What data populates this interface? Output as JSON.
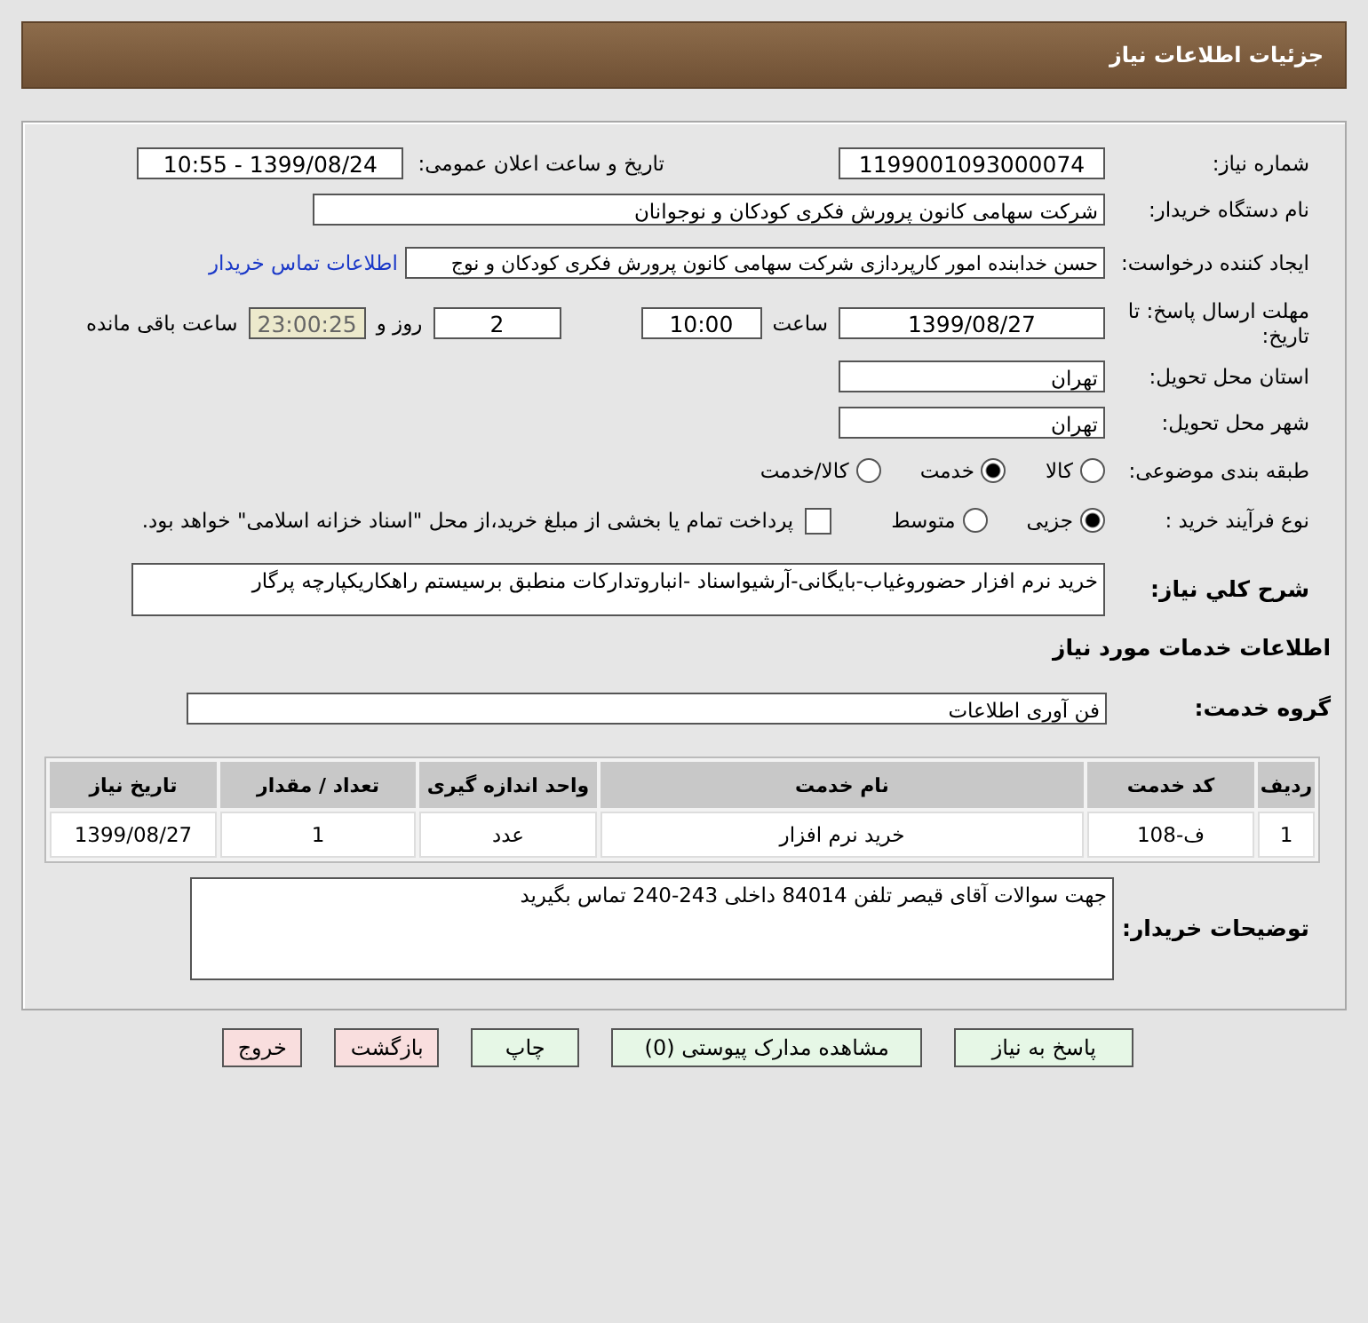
{
  "header": {
    "title": "جزئیات اطلاعات نیاز"
  },
  "need_number": {
    "label": "شماره نیاز:",
    "value": "1199001093000074"
  },
  "announce": {
    "label": "تاریخ و ساعت اعلان عمومی:",
    "value": "1399/08/24 - 10:55"
  },
  "buyer_org": {
    "label": "نام دستگاه خریدار:",
    "value": "شرکت سهامی کانون پرورش فکری کودکان و نوجوانان"
  },
  "requester": {
    "label": "ایجاد کننده درخواست:",
    "value": "حسن خدابنده امور کارپردازی  شرکت سهامی کانون پرورش فکری کودکان و نوج",
    "link": "اطلاعات تماس خریدار"
  },
  "deadline": {
    "label": "مهلت ارسال پاسخ: تا تاریخ:",
    "date": "1399/08/27",
    "time_label": "ساعت",
    "time": "10:00",
    "days": "2",
    "days_label": "روز و",
    "remaining": "23:00:25",
    "remaining_label": "ساعت باقی مانده"
  },
  "province": {
    "label": "استان محل تحویل:",
    "value": "تهران"
  },
  "city": {
    "label": "شهر محل تحویل:",
    "value": "تهران"
  },
  "category": {
    "label": "طبقه بندی موضوعی:",
    "options": [
      {
        "label": "کالا",
        "selected": false
      },
      {
        "label": "خدمت",
        "selected": true
      },
      {
        "label": "کالا/خدمت",
        "selected": false
      }
    ]
  },
  "purchase_process": {
    "label": "نوع فرآیند خرید :",
    "options": [
      {
        "label": "جزیی",
        "selected": true
      },
      {
        "label": "متوسط",
        "selected": false
      }
    ],
    "checkbox": {
      "label": "پرداخت تمام یا بخشی از مبلغ خرید،از محل \"اسناد خزانه اسلامی\" خواهد بود.",
      "checked": false
    }
  },
  "description": {
    "label": "شرح کلي نياز:",
    "value": "خرید نرم افزار حضوروغیاب-بایگانی-آرشیواسناد -انباروتدارکات منطبق برسیستم راهکاریکپارچه پرگار"
  },
  "services_title": "اطلاعات خدمات مورد نیاز",
  "service_group": {
    "label": "گروه خدمت:",
    "value": "فن آوری اطلاعات"
  },
  "table": {
    "columns": [
      "ردیف",
      "کد خدمت",
      "نام خدمت",
      "واحد اندازه گیری",
      "تعداد / مقدار",
      "تاریخ نیاز"
    ],
    "rows": [
      [
        "1",
        "ف-108",
        "خرید نرم افزار",
        "عدد",
        "1",
        "1399/08/27"
      ]
    ]
  },
  "buyer_notes": {
    "label": "توضیحات خریدار:",
    "value": "جهت سوالات آقای قیصر تلفن 84014 داخلی 243-240 تماس بگیرید"
  },
  "buttons": [
    {
      "label": "پاسخ به نیاز",
      "kind": "normal"
    },
    {
      "label": "مشاهده مدارک پیوستی (0)",
      "kind": "normal"
    },
    {
      "label": "چاپ",
      "kind": "normal"
    },
    {
      "label": "بازگشت",
      "kind": "warn"
    },
    {
      "label": "خروج",
      "kind": "warn"
    }
  ]
}
